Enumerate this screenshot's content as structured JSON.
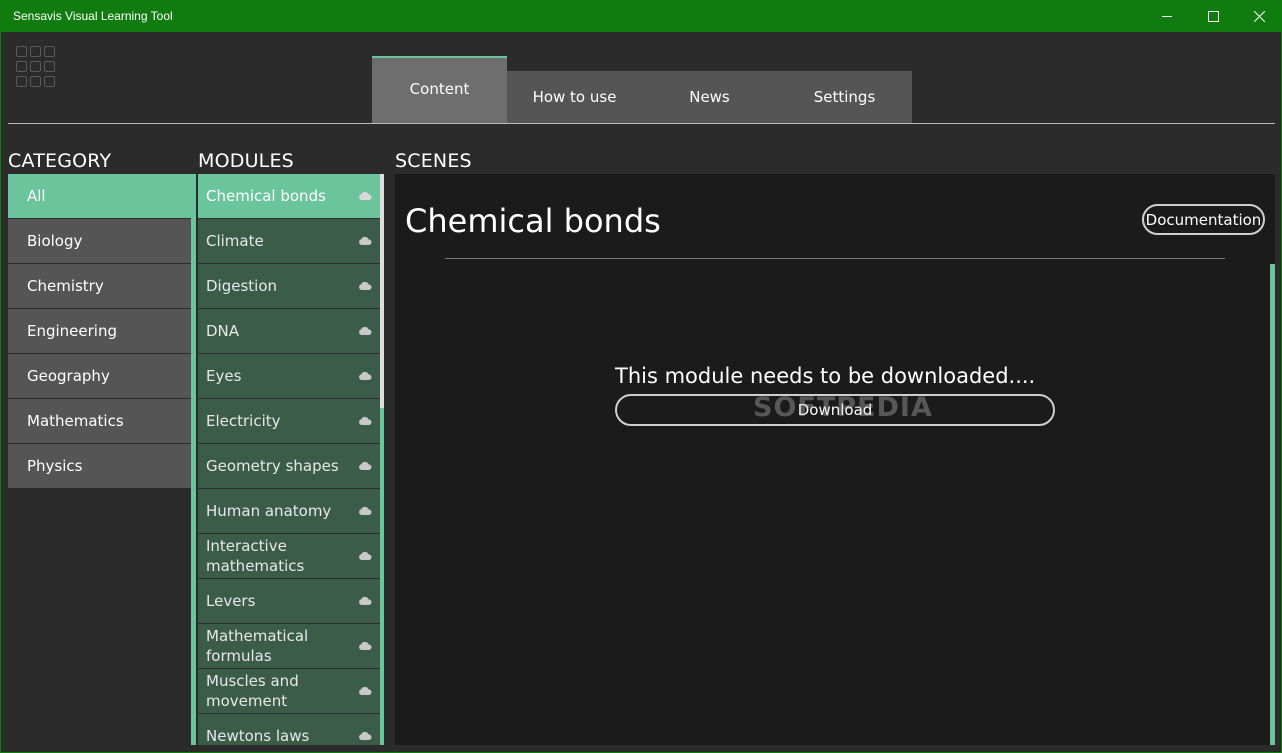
{
  "window": {
    "title": "Sensavis Visual Learning Tool",
    "minimize_icon": "minimize-icon",
    "maximize_icon": "maximize-icon",
    "close_icon": "close-icon"
  },
  "tabs": [
    {
      "label": "Content",
      "active": true
    },
    {
      "label": "How to use",
      "active": false
    },
    {
      "label": "News",
      "active": false
    },
    {
      "label": "Settings",
      "active": false
    }
  ],
  "headers": {
    "category": "CATEGORY",
    "modules": "MODULES",
    "scenes": "SCENES"
  },
  "categories": [
    {
      "label": "All",
      "active": true
    },
    {
      "label": "Biology"
    },
    {
      "label": "Chemistry"
    },
    {
      "label": "Engineering"
    },
    {
      "label": "Geography"
    },
    {
      "label": "Mathematics"
    },
    {
      "label": "Physics"
    }
  ],
  "modules": [
    {
      "label": "Chemical bonds",
      "active": true
    },
    {
      "label": "Climate"
    },
    {
      "label": "Digestion"
    },
    {
      "label": "DNA"
    },
    {
      "label": "Eyes"
    },
    {
      "label": "Electricity"
    },
    {
      "label": "Geometry shapes"
    },
    {
      "label": "Human anatomy"
    },
    {
      "label": "Interactive mathematics"
    },
    {
      "label": "Levers"
    },
    {
      "label": "Mathematical formulas"
    },
    {
      "label": "Muscles and movement"
    },
    {
      "label": "Newtons laws"
    }
  ],
  "scene": {
    "title": "Chemical bonds",
    "documentation_label": "Documentation",
    "download_message": "This module needs to be downloaded....",
    "download_label": "Download",
    "watermark": "SOFTPEDIA"
  },
  "colors": {
    "titlebar": "#107c10",
    "accent": "#6ac59c",
    "module_bg": "#3a5c48",
    "panel_bg": "#1b1b1b"
  }
}
